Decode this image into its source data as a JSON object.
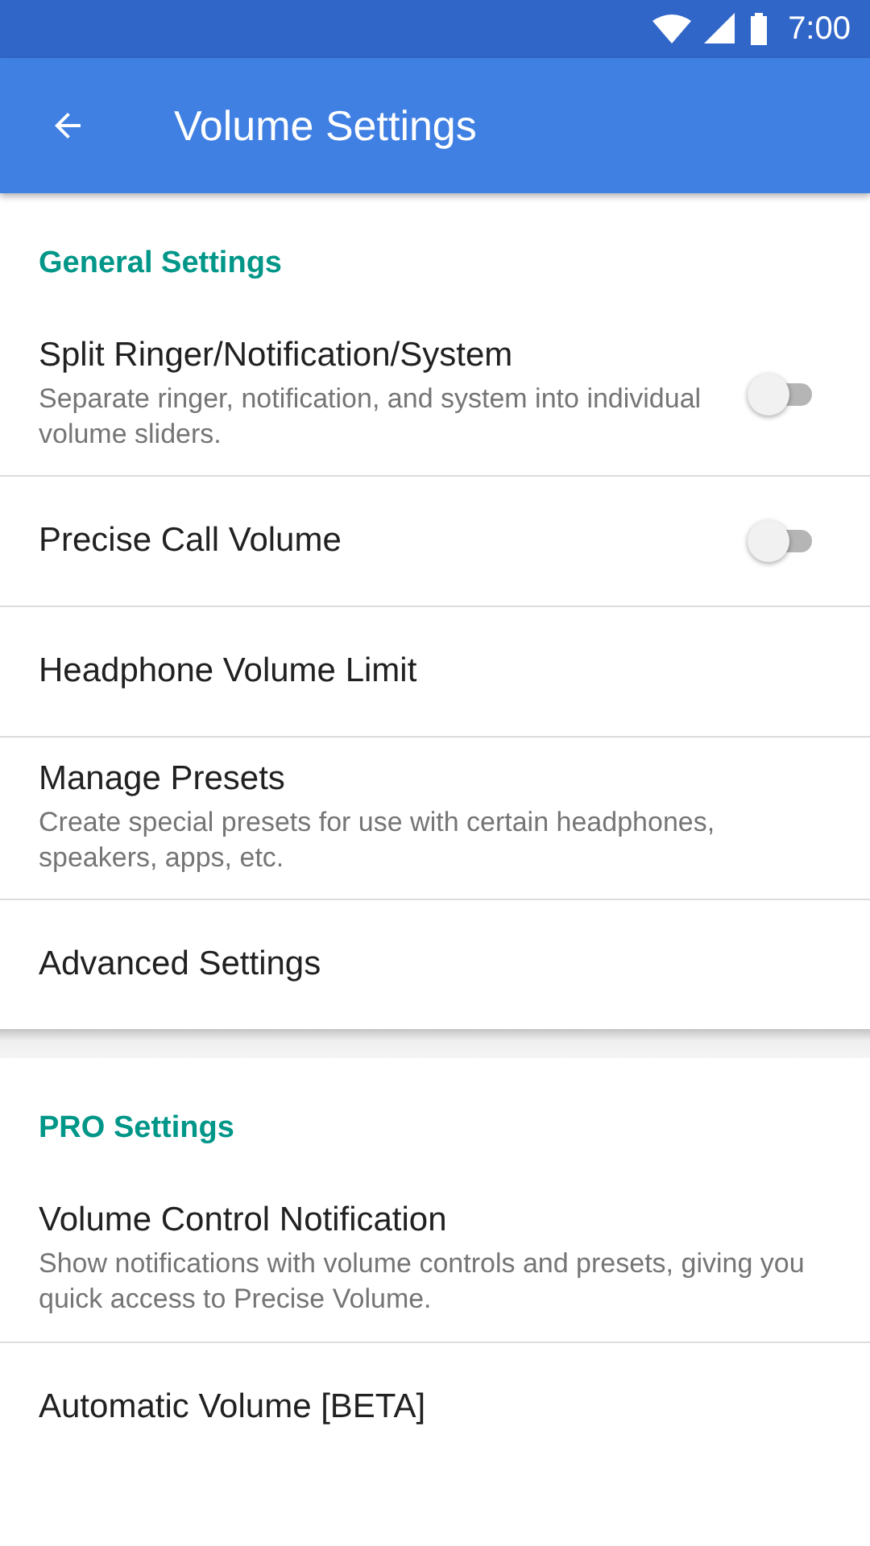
{
  "status_bar": {
    "time": "7:00"
  },
  "app_bar": {
    "title": "Volume Settings"
  },
  "sections": [
    {
      "header": "General Settings",
      "items": [
        {
          "kind": "switch",
          "title": "Split Ringer/Notification/System",
          "summary": "Separate ringer, notification, and system into individual volume sliders.",
          "on": false
        },
        {
          "kind": "switch",
          "title": "Precise Call Volume",
          "on": false
        },
        {
          "kind": "plain",
          "title": "Headphone Volume Limit"
        },
        {
          "kind": "plain",
          "title": "Manage Presets",
          "summary": "Create special presets for use with certain headphones, speakers, apps, etc."
        },
        {
          "kind": "plain",
          "title": "Advanced Settings"
        }
      ]
    },
    {
      "header": "PRO Settings",
      "items": [
        {
          "kind": "plain",
          "title": "Volume Control Notification",
          "summary": "Show notifications with volume controls and presets, giving you quick access to Precise Volume."
        },
        {
          "kind": "plain",
          "title": "Automatic Volume [BETA]"
        }
      ]
    }
  ]
}
